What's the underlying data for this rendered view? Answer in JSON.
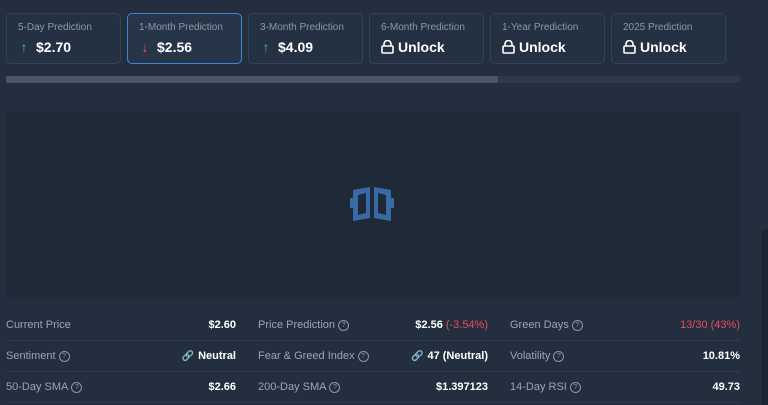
{
  "tabs": [
    {
      "title": "5-Day Prediction",
      "value": "$2.70",
      "icon": "arrow-up-icon"
    },
    {
      "title": "1-Month Prediction",
      "value": "$2.56",
      "icon": "arrow-down-icon"
    },
    {
      "title": "3-Month Prediction",
      "value": "$4.09",
      "icon": "arrow-up-icon"
    },
    {
      "title": "6-Month Prediction",
      "value": "Unlock",
      "icon": "lock-icon"
    },
    {
      "title": "1-Year Prediction",
      "value": "Unlock",
      "icon": "lock-icon"
    },
    {
      "title": "2025 Prediction",
      "value": "Unlock",
      "icon": "lock-icon"
    }
  ],
  "scroll": {
    "fraction": 0.67
  },
  "colors": {
    "up": "#35c47c",
    "down": "#ea4b5d",
    "accent": "#3d86d3"
  },
  "stats": {
    "current_price": {
      "label": "Current Price",
      "value": "$2.60"
    },
    "price_prediction": {
      "label": "Price Prediction",
      "value": "$2.56",
      "change": "(-3.54%)"
    },
    "green_days": {
      "label": "Green Days",
      "value": "13/30 (43%)"
    },
    "sentiment": {
      "label": "Sentiment",
      "value": "Neutral"
    },
    "fear_greed": {
      "label": "Fear & Greed Index",
      "value": "47 (Neutral)"
    },
    "volatility": {
      "label": "Volatility",
      "value": "10.81%"
    },
    "sma50": {
      "label": "50-Day SMA",
      "value": "$2.66"
    },
    "sma200": {
      "label": "200-Day SMA",
      "value": "$1.397123"
    },
    "rsi14": {
      "label": "14-Day RSI",
      "value": "49.73"
    }
  }
}
